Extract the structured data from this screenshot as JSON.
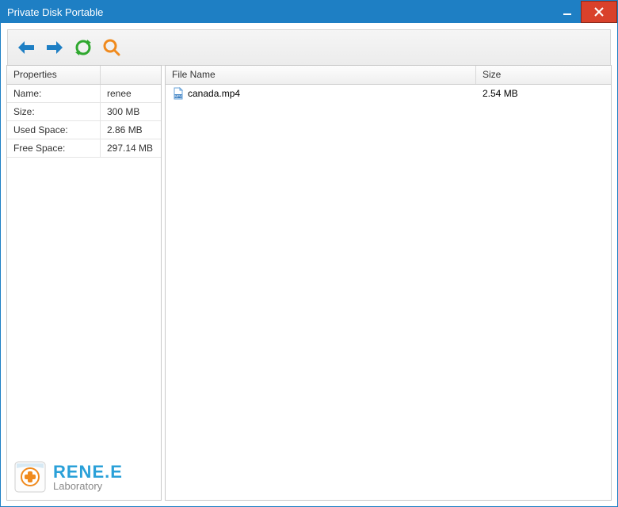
{
  "window": {
    "title": "Private Disk Portable"
  },
  "headers": {
    "properties": "Properties",
    "file_name": "File Name",
    "size": "Size"
  },
  "properties": [
    {
      "label": "Name:",
      "value": "renee"
    },
    {
      "label": "Size:",
      "value": "300 MB"
    },
    {
      "label": "Used Space:",
      "value": "2.86 MB"
    },
    {
      "label": "Free Space:",
      "value": "297.14 MB"
    }
  ],
  "files": [
    {
      "name": "canada.mp4",
      "size": "2.54 MB",
      "type": "mp4"
    }
  ],
  "logo": {
    "line1": "RENE.E",
    "line2": "Laboratory"
  }
}
